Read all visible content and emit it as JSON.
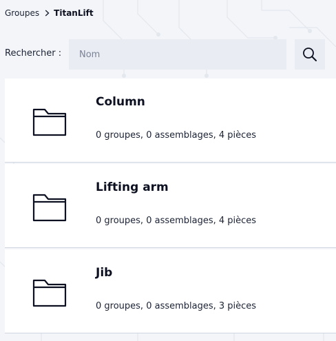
{
  "breadcrumb": {
    "parent": "Groupes",
    "current": "TitanLift"
  },
  "search": {
    "label": "Rechercher :",
    "placeholder": "Nom",
    "value": ""
  },
  "groups": [
    {
      "name": "Column",
      "summary": "0 groupes, 0 assemblages, 4 pièces"
    },
    {
      "name": "Lifting arm",
      "summary": "0 groupes, 0 assemblages, 4 pièces"
    },
    {
      "name": "Jib",
      "summary": "0 groupes, 0 assemblages, 3 pièces"
    }
  ],
  "icons": {
    "breadcrumb_separator": "chevron-right-icon",
    "search": "search-icon",
    "group": "folder-icon"
  },
  "colors": {
    "background": "#f3f5f8",
    "card": "#ffffff",
    "input": "#e9edf3",
    "text": "#0c1020",
    "divider": "#cfd6e2"
  }
}
